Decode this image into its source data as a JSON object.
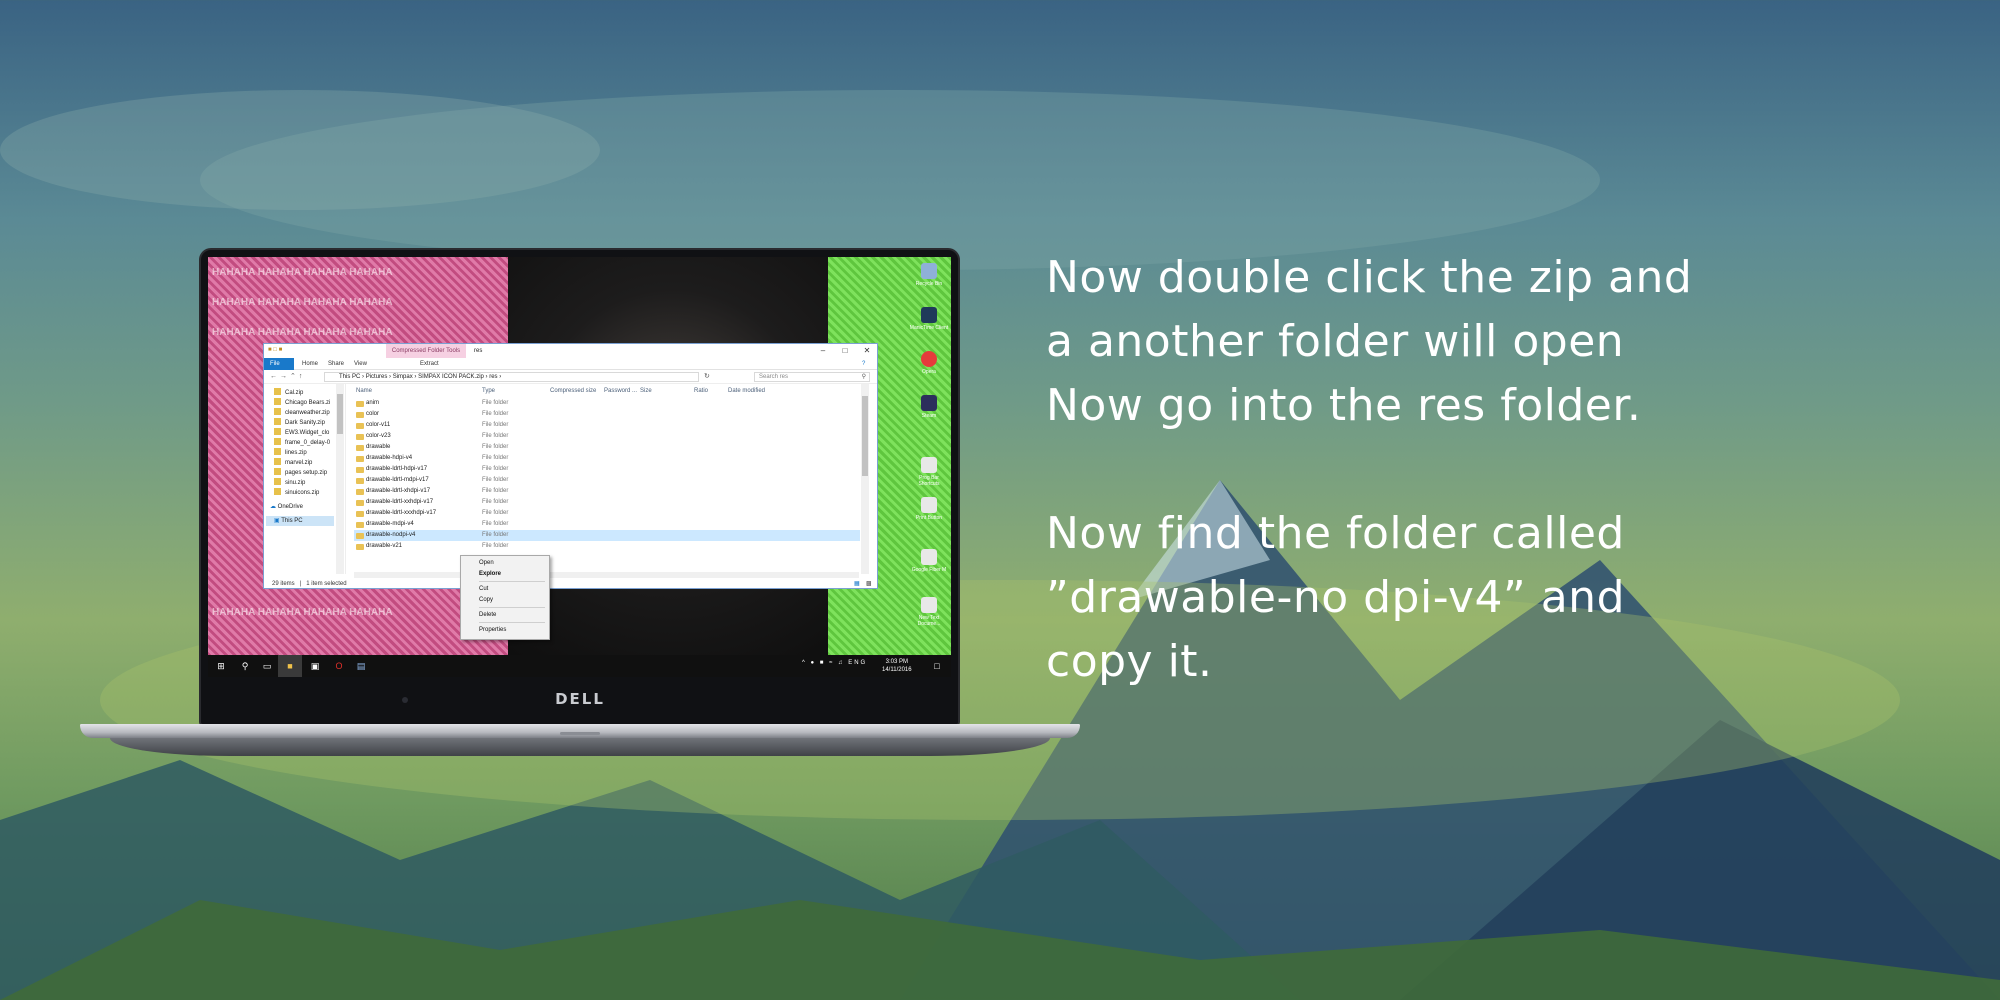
{
  "instructions": {
    "paragraph1": [
      "Now double click the zip and",
      "a another folder will open",
      "Now go into the res folder."
    ],
    "paragraph2": [
      "Now find the folder called",
      "”drawable-no dpi-v4” and",
      "copy it."
    ]
  },
  "laptop": {
    "brand": "DELL"
  },
  "wallpaper": {
    "haha_text": "HAHAHA HAHAHA HAHAHA HAHAHA"
  },
  "desktop_icons": [
    {
      "label": "Recycle Bin",
      "icon": "recycle-bin-icon",
      "color": "#8fb0d8"
    },
    {
      "label": "ManicTime Client",
      "icon": "app-icon",
      "color": "#1f3a5a"
    },
    {
      "label": "Opera",
      "icon": "opera-icon",
      "color": "#e53b3b"
    },
    {
      "label": "Steam",
      "icon": "steam-icon",
      "color": "#2c2e5c"
    },
    {
      "label": "Prog Bar Shortcuts",
      "icon": "document-icon",
      "color": "#e8e8e8"
    },
    {
      "label": "Print Button",
      "icon": "document-icon",
      "color": "#e8e8e8"
    },
    {
      "label": "Google Fiber M",
      "icon": "document-icon",
      "color": "#e8e8e8"
    },
    {
      "label": "New Text Docume...",
      "icon": "document-icon",
      "color": "#e8e8e8"
    }
  ],
  "explorer": {
    "context_tab": "Compressed Folder Tools",
    "window_title": "res",
    "ribbon_tabs": [
      "File",
      "Home",
      "Share",
      "View",
      "Extract"
    ],
    "path": [
      "This PC",
      "Pictures",
      "Simpax",
      "SIMPAX ICON PACK.zip",
      "res"
    ],
    "search_placeholder": "Search res",
    "nav_items": [
      "Cal.zip",
      "Chicago Bears.zi",
      "cleanweather.zip",
      "Dark Sanity.zip",
      "EW3.Widget_clo",
      "frame_0_delay-0",
      "lines.zip",
      "marvel.zip",
      "pages setup.zip",
      "sinu.zip",
      "sinuicons.zip"
    ],
    "nav_onedrive": "OneDrive",
    "nav_thispc": "This PC",
    "columns": [
      "Name",
      "Type",
      "Compressed size",
      "Password ...",
      "Size",
      "Ratio",
      "Date modified"
    ],
    "rows": [
      {
        "name": "anim",
        "type": "File folder"
      },
      {
        "name": "color",
        "type": "File folder"
      },
      {
        "name": "color-v11",
        "type": "File folder"
      },
      {
        "name": "color-v23",
        "type": "File folder"
      },
      {
        "name": "drawable",
        "type": "File folder"
      },
      {
        "name": "drawable-hdpi-v4",
        "type": "File folder"
      },
      {
        "name": "drawable-ldrtl-hdpi-v17",
        "type": "File folder"
      },
      {
        "name": "drawable-ldrtl-mdpi-v17",
        "type": "File folder"
      },
      {
        "name": "drawable-ldrtl-xhdpi-v17",
        "type": "File folder"
      },
      {
        "name": "drawable-ldrtl-xxhdpi-v17",
        "type": "File folder"
      },
      {
        "name": "drawable-ldrtl-xxxhdpi-v17",
        "type": "File folder"
      },
      {
        "name": "drawable-mdpi-v4",
        "type": "File folder"
      },
      {
        "name": "drawable-nodpi-v4",
        "type": "File folder"
      },
      {
        "name": "drawable-v21",
        "type": "File folder"
      }
    ],
    "selected_row": "drawable-nodpi-v4",
    "status_items": "29 items",
    "status_selected": "1 item selected"
  },
  "context_menu": {
    "open": "Open",
    "explore": "Explore",
    "cut": "Cut",
    "copy": "Copy",
    "delete": "Delete",
    "properties": "Properties"
  },
  "taskbar": {
    "language": "ENG",
    "time": "3:03 PM",
    "date": "14/11/2016"
  },
  "colors": {
    "accent": "#1979ca",
    "selection": "#cce8ff",
    "text_overlay": "#ffffff"
  }
}
